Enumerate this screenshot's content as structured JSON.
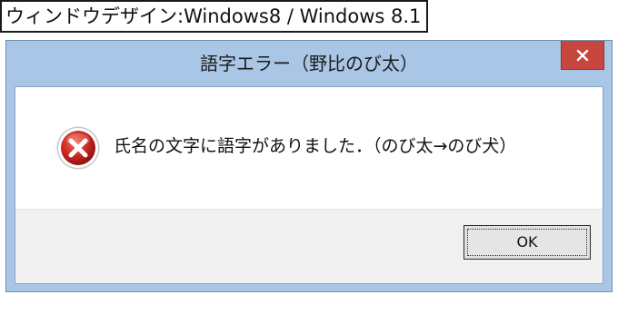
{
  "caption": {
    "text": "ウィンドウデザイン:Windows8 / Windows 8.1"
  },
  "dialog": {
    "title": "語字エラー（野比のび太）",
    "close_icon": "close-icon",
    "message": "氏名の文字に語字がありました．（のび太→のび犬）",
    "icon": "error-icon",
    "ok_label": "OK"
  },
  "colors": {
    "frame": "#a9c6e6",
    "close_button": "#c7463d",
    "button_area": "#f0f0f0"
  }
}
